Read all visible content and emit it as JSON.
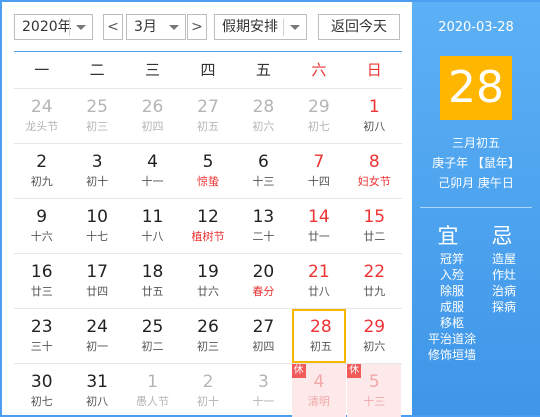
{
  "toolbar": {
    "year": "2020年",
    "prev": "<",
    "month": "3月",
    "next": ">",
    "holiday": "假期安排",
    "today": "返回今天"
  },
  "weekdays": [
    "一",
    "二",
    "三",
    "四",
    "五",
    "六",
    "日"
  ],
  "weeks": [
    [
      {
        "day": "24",
        "lunar": "龙头节",
        "other": true
      },
      {
        "day": "25",
        "lunar": "初三",
        "other": true
      },
      {
        "day": "26",
        "lunar": "初四",
        "other": true
      },
      {
        "day": "27",
        "lunar": "初五",
        "other": true
      },
      {
        "day": "28",
        "lunar": "初六",
        "other": true
      },
      {
        "day": "29",
        "lunar": "初七",
        "other": true
      },
      {
        "day": "1",
        "lunar": "初八"
      }
    ],
    [
      {
        "day": "2",
        "lunar": "初九"
      },
      {
        "day": "3",
        "lunar": "初十"
      },
      {
        "day": "4",
        "lunar": "十一"
      },
      {
        "day": "5",
        "lunar": "惊蛰",
        "festival": true
      },
      {
        "day": "6",
        "lunar": "十三"
      },
      {
        "day": "7",
        "lunar": "十四"
      },
      {
        "day": "8",
        "lunar": "妇女节",
        "festival": true
      }
    ],
    [
      {
        "day": "9",
        "lunar": "十六"
      },
      {
        "day": "10",
        "lunar": "十七"
      },
      {
        "day": "11",
        "lunar": "十八"
      },
      {
        "day": "12",
        "lunar": "植树节",
        "festival": true
      },
      {
        "day": "13",
        "lunar": "二十"
      },
      {
        "day": "14",
        "lunar": "廿一"
      },
      {
        "day": "15",
        "lunar": "廿二"
      }
    ],
    [
      {
        "day": "16",
        "lunar": "廿三"
      },
      {
        "day": "17",
        "lunar": "廿四"
      },
      {
        "day": "18",
        "lunar": "廿五"
      },
      {
        "day": "19",
        "lunar": "廿六"
      },
      {
        "day": "20",
        "lunar": "春分",
        "festival": true
      },
      {
        "day": "21",
        "lunar": "廿八"
      },
      {
        "day": "22",
        "lunar": "廿九"
      }
    ],
    [
      {
        "day": "23",
        "lunar": "三十"
      },
      {
        "day": "24",
        "lunar": "初一"
      },
      {
        "day": "25",
        "lunar": "初二"
      },
      {
        "day": "26",
        "lunar": "初三"
      },
      {
        "day": "27",
        "lunar": "初四"
      },
      {
        "day": "28",
        "lunar": "初五",
        "selected": true
      },
      {
        "day": "29",
        "lunar": "初六"
      }
    ],
    [
      {
        "day": "30",
        "lunar": "初七"
      },
      {
        "day": "31",
        "lunar": "初八"
      },
      {
        "day": "1",
        "lunar": "愚人节",
        "other": true
      },
      {
        "day": "2",
        "lunar": "初十",
        "other": true
      },
      {
        "day": "3",
        "lunar": "十一",
        "other": true
      },
      {
        "day": "4",
        "lunar": "清明",
        "other": true,
        "holiday": true,
        "badge": "休"
      },
      {
        "day": "5",
        "lunar": "十三",
        "other": true,
        "holiday": true,
        "badge": "休"
      }
    ]
  ],
  "panel": {
    "date": "2020-03-28",
    "big_day": "28",
    "lunar_date": "三月初五",
    "year_ganzhi": "庚子年 【鼠年】",
    "month_day_ganzhi": "己卯月 庚午日",
    "yi_title": "宜",
    "ji_title": "忌",
    "yi": [
      "冠笄",
      "入殓",
      "除服",
      "成服",
      "移柩",
      "平治道涂",
      "修饰垣墙"
    ],
    "ji": [
      "造屋",
      "作灶",
      "治病",
      "探病"
    ]
  },
  "colors": {
    "accent": "#4d9ef0",
    "weekend_red": "#e33333",
    "selected_border": "#f5b700",
    "big_day_bg": "#ffb600",
    "holiday_bg": "#fde9e9"
  }
}
